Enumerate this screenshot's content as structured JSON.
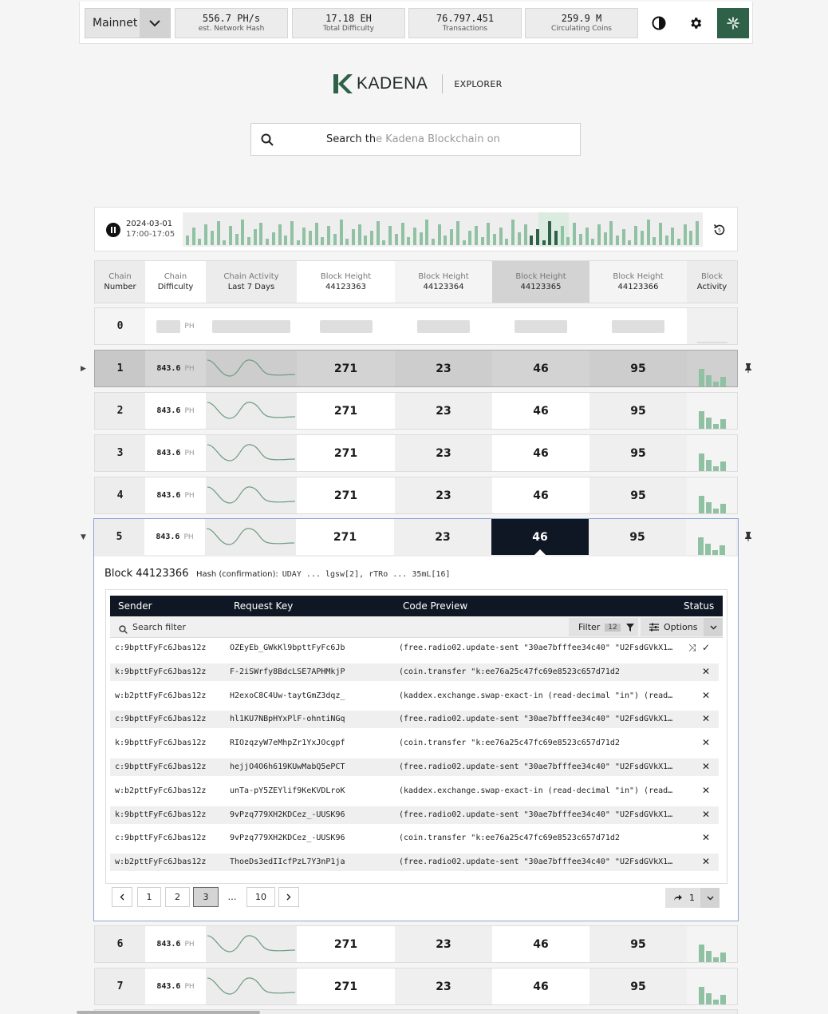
{
  "topbar": {
    "network": "Mainnet",
    "stats": [
      {
        "value": "556.7 PH/s",
        "label": "est. Network Hash"
      },
      {
        "value": "17.18 EH",
        "label": "Total Difficulty"
      },
      {
        "value": "76.797.451",
        "label": "Transactions"
      },
      {
        "value": "259.9 M",
        "label": "Circulating Coins"
      }
    ]
  },
  "brand": {
    "name": "KADENA",
    "section": "EXPLORER"
  },
  "search": {
    "typed": "Search th",
    "placeholder": "e Kadena Blockchain on"
  },
  "activity": {
    "date": "2024-03-01",
    "time": "17:00-17:05"
  },
  "columns": {
    "chain_number": [
      "Chain",
      "Number"
    ],
    "chain_difficulty": [
      "Chain",
      "Difficulty"
    ],
    "chain_activity": [
      "Chain Activity",
      "Last 7 Days"
    ],
    "block_label": "Block Height",
    "heights": [
      "44123363",
      "44123364",
      "44123365",
      "44123366"
    ],
    "block_activity": [
      "Block",
      "Activity"
    ]
  },
  "rows": [
    {
      "chain": "0",
      "difficulty": "",
      "unit": "PH"
    },
    {
      "chain": "1",
      "difficulty": "843.6",
      "unit": "PH",
      "h": [
        "271",
        "23",
        "46",
        "95"
      ]
    },
    {
      "chain": "2",
      "difficulty": "843.6",
      "unit": "PH",
      "h": [
        "271",
        "23",
        "46",
        "95"
      ]
    },
    {
      "chain": "3",
      "difficulty": "843.6",
      "unit": "PH",
      "h": [
        "271",
        "23",
        "46",
        "95"
      ]
    },
    {
      "chain": "4",
      "difficulty": "843.6",
      "unit": "PH",
      "h": [
        "271",
        "23",
        "46",
        "95"
      ]
    },
    {
      "chain": "5",
      "difficulty": "843.6",
      "unit": "PH",
      "h": [
        "271",
        "23",
        "46",
        "95"
      ]
    },
    {
      "chain": "6",
      "difficulty": "843.6",
      "unit": "PH",
      "h": [
        "271",
        "23",
        "46",
        "95"
      ]
    },
    {
      "chain": "7",
      "difficulty": "843.6",
      "unit": "PH",
      "h": [
        "271",
        "23",
        "46",
        "95"
      ]
    }
  ],
  "block": {
    "title": "Block 44123366",
    "hash_label": "Hash (confirmation):",
    "hash_value": "UDAY ... lgsw[2], rTRo ... 35mL[16]",
    "columns": [
      "Sender",
      "Request Key",
      "Code Preview",
      "Status"
    ],
    "filter_placeholder": "Search filter",
    "filter_label": "Filter",
    "filter_count": "12",
    "options_label": "Options",
    "tx": [
      {
        "sender": "c:9bpttFyFc6Jbas12z",
        "key": "OZEyEb_GWkKl9bpttFyFc6Jb",
        "code": "(free.radio02.update-sent \"30ae7bfffee34c40\" \"U2FsdGVkX1..."
      },
      {
        "sender": "k:9bpttFyFc6Jbas12z",
        "key": "F-2iSWrfy8BdcLSE7APHMkjP",
        "code": "(coin.transfer \"k:ee76a25c47fc69e8523c657d71d2"
      },
      {
        "sender": "w:b2pttFyFc6Jbas12z",
        "key": "H2exoC8C4Uw-taytGmZ3dqz_",
        "code": "(kaddex.exchange.swap-exact-in (read-decimal \"in\") (read..."
      },
      {
        "sender": "c:9bpttFyFc6Jbas12z",
        "key": "hl1KU7NBpHYxPlF-ohntiNGq",
        "code": "(free.radio02.update-sent \"30ae7bfffee34c40\" \"U2FsdGVkX1..."
      },
      {
        "sender": "k:9bpttFyFc6Jbas12z",
        "key": "RIOzqzyW7eMhpZr1YxJOcgpf",
        "code": "(coin.transfer \"k:ee76a25c47fc69e8523c657d71d2"
      },
      {
        "sender": "c:9bpttFyFc6Jbas12z",
        "key": "hejjO4O6h619KUwMabQ5ePCT",
        "code": "(free.radio02.update-sent \"30ae7bfffee34c40\" \"U2FsdGVkX1..."
      },
      {
        "sender": "w:b2pttFyFc6Jbas12z",
        "key": "unTa-pY5ZEYlif9KeKVDLroK",
        "code": "(kaddex.exchange.swap-exact-in (read-decimal \"in\") (read..."
      },
      {
        "sender": "k:9bpttFyFc6Jbas12z",
        "key": "9vPzq779XH2KDCez_-UUSK96",
        "code": "(free.radio02.update-sent \"30ae7bfffee34c40\" \"U2FsdGVkX1..."
      },
      {
        "sender": "c:9bpttFyFc6Jbas12z",
        "key": "9vPzq779XH2KDCez_-UUSK96",
        "code": "(coin.transfer \"k:ee76a25c47fc69e8523c657d71d2"
      },
      {
        "sender": "w:b2pttFyFc6Jbas12z",
        "key": "ThoeDs3edIIcfPzL7Y3nP1ja",
        "code": "(free.radio02.update-sent \"30ae7bfffee34c40\" \"U2FsdGVkX1..."
      }
    ],
    "pager": {
      "pages": [
        "1",
        "2",
        "3",
        "…",
        "10"
      ],
      "current": "3",
      "goto": "1"
    }
  },
  "colors": {
    "accent_green": "#2e6148",
    "bar_green": "#8fc1a2",
    "dark_navy": "#101724"
  }
}
